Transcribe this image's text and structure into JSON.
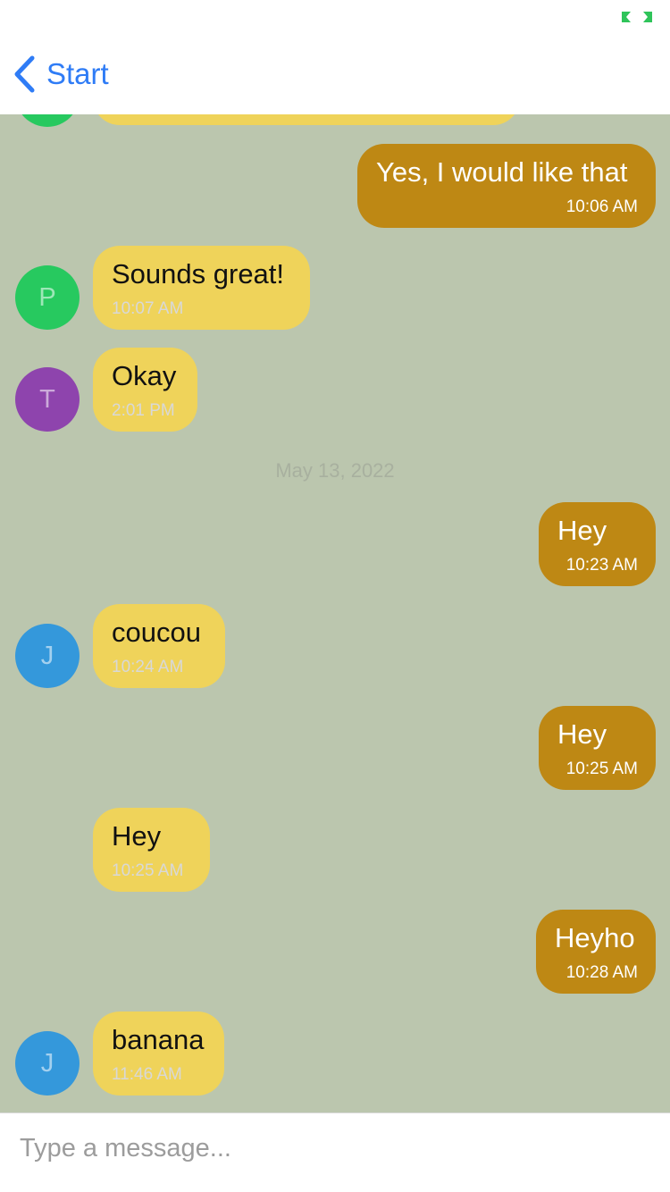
{
  "nav": {
    "back_label": "Start"
  },
  "colors": {
    "accent": "#2f7cf6",
    "chat_background": "#bbc6ae",
    "incoming_bubble": "#efd35a",
    "outgoing_bubble": "#be8814"
  },
  "messages": [
    {
      "direction": "out",
      "text": "Yes, I would like that",
      "time": "10:06 AM"
    },
    {
      "direction": "in",
      "text": "Sounds great!",
      "time": "10:07 AM",
      "avatar": {
        "initial": "P",
        "color": "#27c95f"
      }
    },
    {
      "direction": "in",
      "text": "Okay",
      "time": "2:01 PM",
      "avatar": {
        "initial": "T",
        "color": "#8e44ad"
      }
    },
    {
      "direction": "out",
      "text": "Hey",
      "time": "10:23 AM"
    },
    {
      "direction": "in",
      "text": "coucou",
      "time": "10:24 AM",
      "avatar": {
        "initial": "J",
        "color": "#3498db"
      }
    },
    {
      "direction": "out",
      "text": "Hey",
      "time": "10:25 AM"
    },
    {
      "direction": "in",
      "text": "Hey",
      "time": "10:25 AM"
    },
    {
      "direction": "out",
      "text": "Heyho",
      "time": "10:28 AM"
    },
    {
      "direction": "in",
      "text": "banana",
      "time": "11:46 AM",
      "avatar": {
        "initial": "J",
        "color": "#3498db"
      }
    }
  ],
  "date_separator": "May 13, 2022",
  "composer": {
    "placeholder": "Type a message..."
  }
}
